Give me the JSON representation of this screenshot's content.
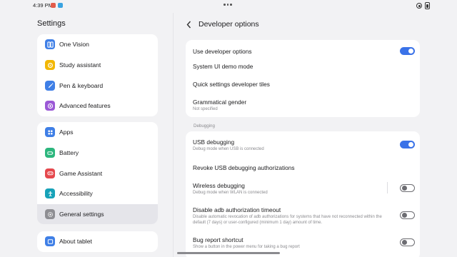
{
  "status_bar": {
    "time": "4:39 PM"
  },
  "colors": {
    "accent": "#3a72e8",
    "background": "#f2f2f4",
    "card": "#ffffff"
  },
  "sidebar": {
    "title": "Settings",
    "groups": [
      [
        {
          "label": "One Vision",
          "icon": "one-vision-icon"
        },
        {
          "label": "Study assistant",
          "icon": "study-assistant-icon"
        },
        {
          "label": "Pen & keyboard",
          "icon": "pen-icon"
        },
        {
          "label": "Advanced features",
          "icon": "advanced-features-icon"
        }
      ],
      [
        {
          "label": "Apps",
          "icon": "apps-icon"
        },
        {
          "label": "Battery",
          "icon": "battery-icon"
        },
        {
          "label": "Game Assistant",
          "icon": "game-icon"
        },
        {
          "label": "Accessibility",
          "icon": "accessibility-icon"
        },
        {
          "label": "General settings",
          "icon": "gear-icon",
          "selected": true
        }
      ],
      [
        {
          "label": "About tablet",
          "icon": "tablet-icon"
        }
      ]
    ]
  },
  "page": {
    "title": "Developer options",
    "back_icon": "chevron-left-icon",
    "general": {
      "use_developer_options": {
        "label": "Use developer options",
        "enabled": true
      },
      "system_ui_demo": {
        "label": "System UI demo mode"
      },
      "quick_settings": {
        "label": "Quick settings developer tiles"
      },
      "grammatical_gender": {
        "label": "Grammatical gender",
        "value": "Not specified"
      }
    },
    "debugging": {
      "section_label": "Debugging",
      "usb_debugging": {
        "label": "USB debugging",
        "description": "Debug mode when USB is connected",
        "enabled": true
      },
      "revoke_usb": {
        "label": "Revoke USB debugging authorizations"
      },
      "wireless_debugging": {
        "label": "Wireless debugging",
        "description": "Debug mode when WLAN is connected",
        "enabled": false
      },
      "adb_timeout": {
        "label": "Disable adb authorization timeout",
        "description": "Disable automatic revocation of adb authorizations for systems that have not reconnected within the default (7 days) or user-configured (minimum 1 day) amount of time.",
        "enabled": false
      },
      "bug_report": {
        "label": "Bug report shortcut",
        "description": "Show a button in the power menu for taking a bug report",
        "enabled": false
      }
    }
  }
}
